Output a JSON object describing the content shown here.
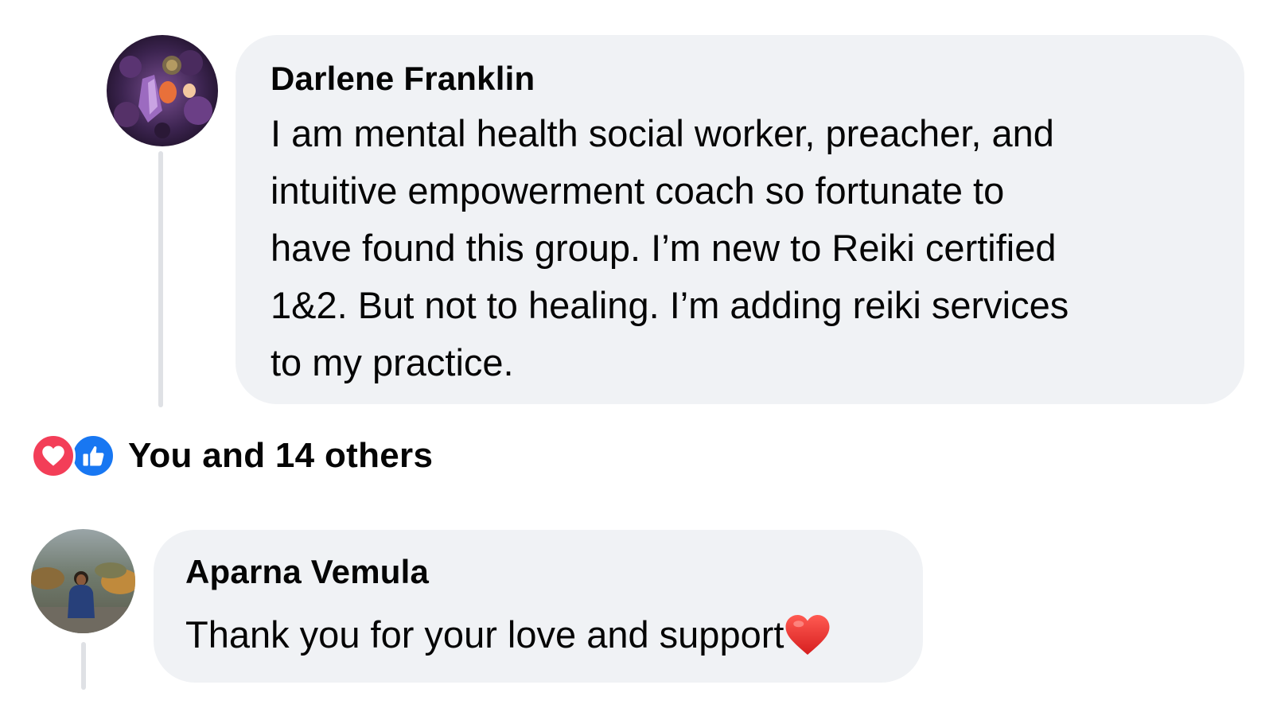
{
  "comments": [
    {
      "author": "Darlene Franklin",
      "text": "I am mental health social worker, preacher, and\nintuitive empowerment coach so fortunate to\nhave found this group. I’m new to Reiki certified\n1&2. But not to healing.  I’m adding reiki services\nto my practice.",
      "avatar_icon": "amethyst-crystal-avatar"
    },
    {
      "author": "Aparna Vemula",
      "text": "Thank you for your love and support",
      "emoji": "red-heart-emoji",
      "avatar_icon": "person-outdoors-avatar"
    }
  ],
  "reactions": {
    "summary": "You and 14 others",
    "types": [
      "love-icon",
      "like-icon"
    ],
    "love_color": "#f33e58",
    "like_color": "#1877f2"
  },
  "colors": {
    "bubble_bg": "#f0f2f5",
    "thread_line": "#dfe1e5",
    "text": "#050505"
  }
}
